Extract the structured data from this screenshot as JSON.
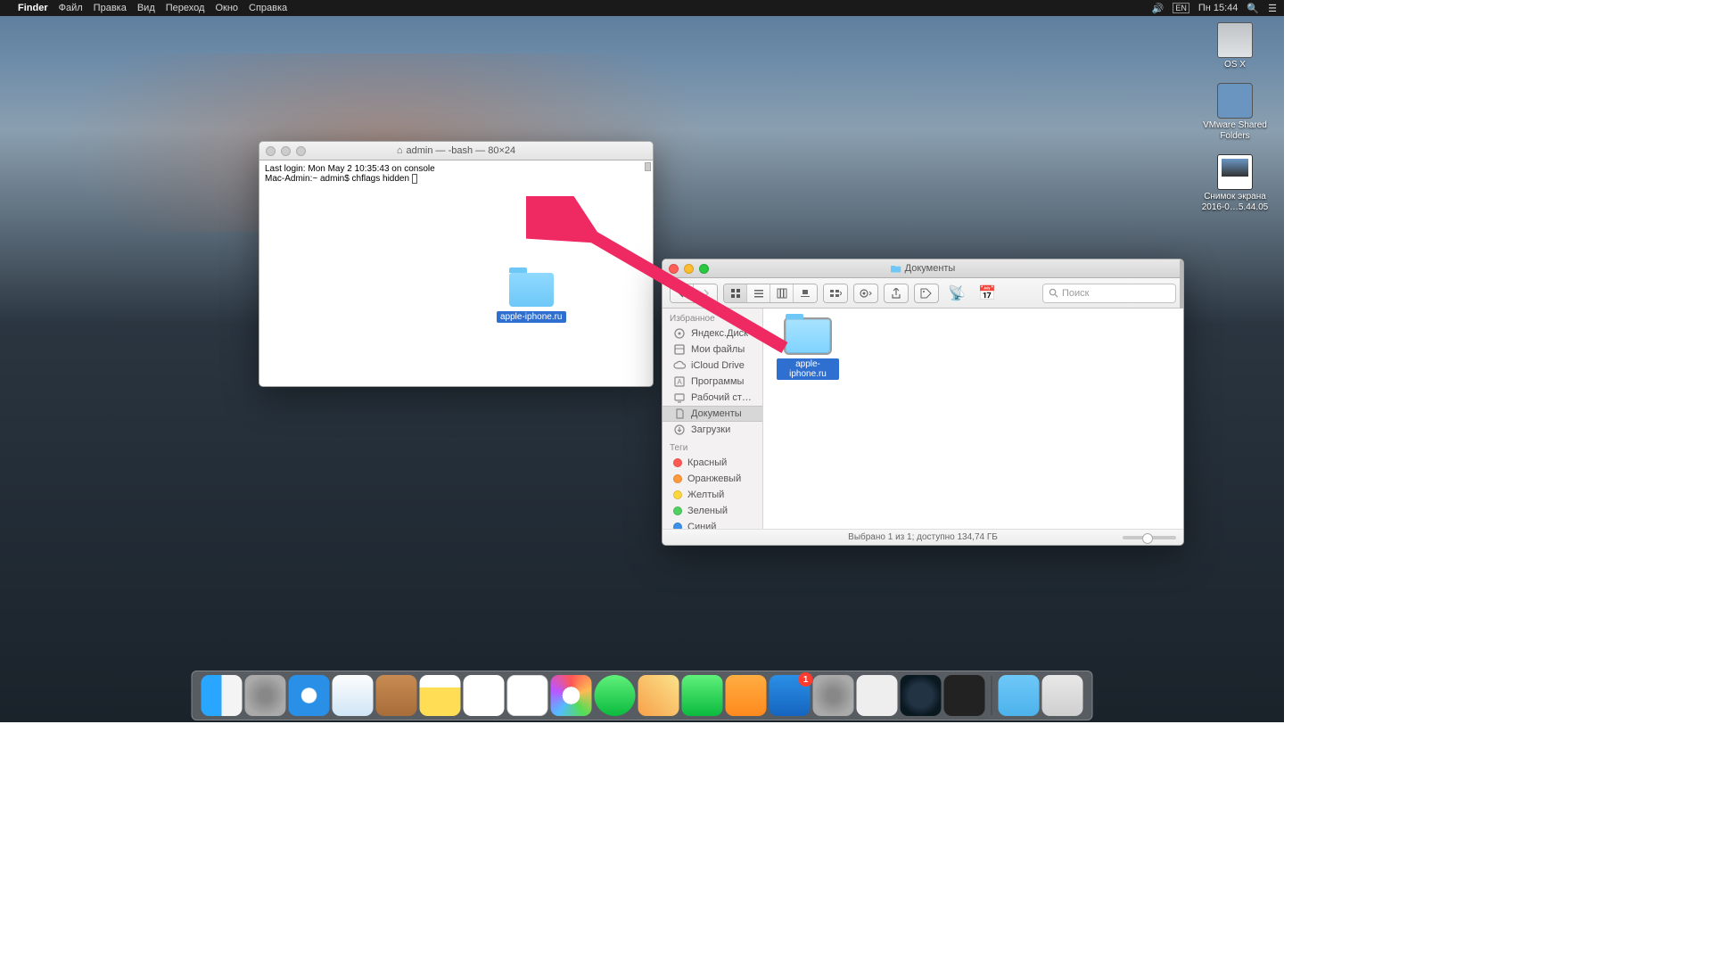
{
  "menubar": {
    "app": "Finder",
    "items": [
      "Файл",
      "Правка",
      "Вид",
      "Переход",
      "Окно",
      "Справка"
    ],
    "lang": "EN",
    "clock": "Пн 15:44"
  },
  "desktop_icons": [
    {
      "name": "OS X",
      "kind": "drive"
    },
    {
      "name": "VMware Shared Folders",
      "kind": "folder"
    },
    {
      "name": "Снимок экрана 2016-0…5.44.05",
      "kind": "shot"
    }
  ],
  "terminal": {
    "title": "admin — -bash — 80×24",
    "line1": "Last login: Mon May  2 10:35:43 on console",
    "line2_prompt": "Mac-Admin:~ admin$ ",
    "line2_cmd": "chflags hidden ",
    "dropped_folder": "apple-iphone.ru"
  },
  "finder": {
    "title": "Документы",
    "search_placeholder": "Поиск",
    "sidebar": {
      "fav_header": "Избранное",
      "items": [
        {
          "label": "Яндекс.Диск",
          "icon": "disk"
        },
        {
          "label": "Мои файлы",
          "icon": "allfiles"
        },
        {
          "label": "iCloud Drive",
          "icon": "cloud"
        },
        {
          "label": "Программы",
          "icon": "apps"
        },
        {
          "label": "Рабочий ст…",
          "icon": "desktop"
        },
        {
          "label": "Документы",
          "icon": "docs",
          "selected": true
        },
        {
          "label": "Загрузки",
          "icon": "downloads"
        }
      ],
      "tags_header": "Теги",
      "tags": [
        {
          "label": "Красный",
          "color": "#ff5a52"
        },
        {
          "label": "Оранжевый",
          "color": "#ff9a3c"
        },
        {
          "label": "Желтый",
          "color": "#ffd63c"
        },
        {
          "label": "Зеленый",
          "color": "#4fd060"
        },
        {
          "label": "Синий",
          "color": "#3a8fe8"
        }
      ]
    },
    "file_label": "apple-iphone.ru",
    "status": "Выбрано 1 из 1; доступно 134,74 ГБ"
  },
  "dock": {
    "apps": [
      {
        "name": "finder-app",
        "cls": "finder"
      },
      {
        "name": "launchpad-app",
        "cls": "launchpad"
      },
      {
        "name": "safari-app",
        "cls": "safari"
      },
      {
        "name": "mail-app",
        "cls": "mail"
      },
      {
        "name": "contacts-app",
        "cls": "contacts"
      },
      {
        "name": "notes-app",
        "cls": "notes"
      },
      {
        "name": "reminders-app",
        "cls": "reminders"
      },
      {
        "name": "calendar-app",
        "cls": "calendar"
      },
      {
        "name": "photos-app",
        "cls": "photos"
      },
      {
        "name": "messages-app",
        "cls": "messages"
      },
      {
        "name": "maps-app",
        "cls": "maps"
      },
      {
        "name": "facetime-app",
        "cls": "facetime"
      },
      {
        "name": "ibooks-app",
        "cls": "ibooks"
      },
      {
        "name": "appstore-app",
        "cls": "appstore",
        "badge": "1"
      },
      {
        "name": "sysprefs-app",
        "cls": "sysprefs"
      },
      {
        "name": "paint-app",
        "cls": "paint"
      },
      {
        "name": "quicktime-app",
        "cls": "quicktime"
      },
      {
        "name": "terminal-app",
        "cls": "terminal"
      }
    ],
    "right": [
      {
        "name": "downloads-stack",
        "cls": "downloads"
      },
      {
        "name": "trash",
        "cls": "trash"
      }
    ]
  }
}
